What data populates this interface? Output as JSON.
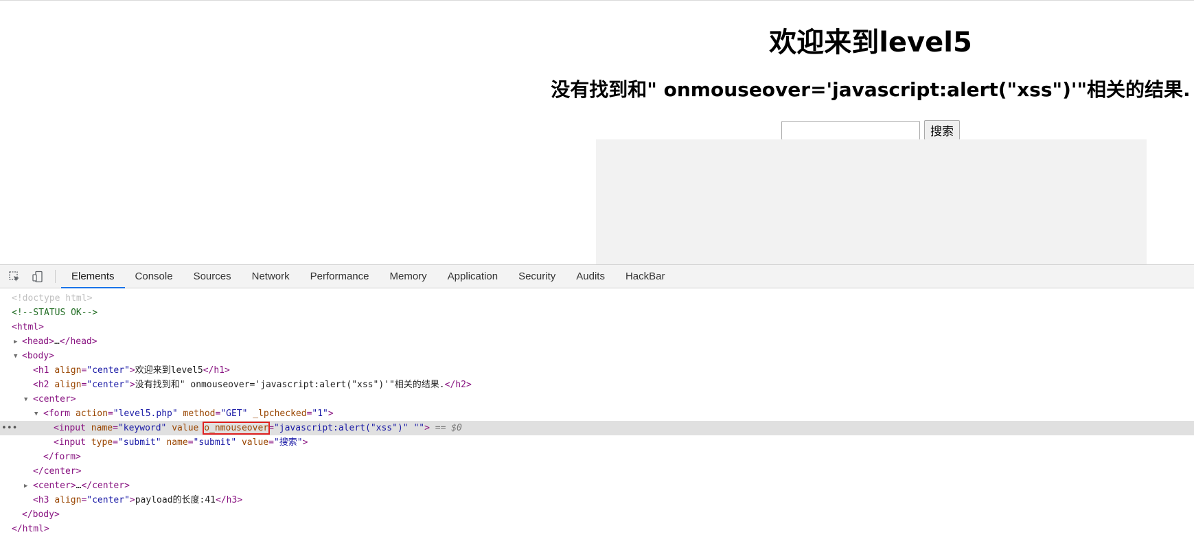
{
  "page": {
    "h1": "欢迎来到level5",
    "h2": "没有找到和\" onmouseover='javascript:alert(\"xss\")'\"相关的结果.",
    "input_value": "",
    "search_label": "搜索"
  },
  "devtools": {
    "tabs": [
      "Elements",
      "Console",
      "Sources",
      "Network",
      "Performance",
      "Memory",
      "Application",
      "Security",
      "Audits",
      "HackBar"
    ],
    "active_tab": "Elements",
    "icons": [
      "inspect-element-icon",
      "device-toolbar-icon"
    ],
    "dom": {
      "doctype": "<!doctype html>",
      "comment": "<!--STATUS OK-->",
      "html_open": "<html>",
      "head": "<head>",
      "head_ellipsis": "…",
      "head_close": "</head>",
      "body_open": "<body>",
      "h1_open": "<h1",
      "h1_attr": "align",
      "h1_val": "\"center\"",
      "h1_text": "欢迎来到level5",
      "h1_close": "</h1>",
      "h2_open": "<h2",
      "h2_attr": "align",
      "h2_val": "\"center\"",
      "h2_text": "没有找到和\" onmouseover='javascript:alert(\"xss\")'\"相关的结果.",
      "h2_close": "</h2>",
      "center_open": "<center>",
      "form_open": "<form",
      "form_action_attr": "action",
      "form_action_val": "\"level5.php\"",
      "form_method_attr": "method",
      "form_method_val": "\"GET\"",
      "form_lp_attr": "_lpchecked",
      "form_lp_val": "\"1\"",
      "input1_open": "<input",
      "input1_name_attr": "name",
      "input1_name_val": "\"keyword\"",
      "input1_value_attr": "value",
      "input1_injected_attr": "o_nmouseover",
      "input1_injected_val": "\"javascript:alert(\"xss\")\"",
      "input1_empty_attr": "\"\"",
      "input1_suffix": "== $0",
      "input2_open": "<input",
      "input2_type_attr": "type",
      "input2_type_val": "\"submit\"",
      "input2_name_attr": "name",
      "input2_name_val": "\"submit\"",
      "input2_value_attr": "value",
      "input2_value_val": "\"搜索\"",
      "form_close": "</form>",
      "center_close": "</center>",
      "center2_open": "<center>",
      "center2_ellipsis": "…",
      "center2_close": "</center>",
      "h3_open": "<h3",
      "h3_attr": "align",
      "h3_val": "\"center\"",
      "h3_text": "payload的长度:41",
      "h3_close": "</h3>",
      "body_close": "</body>",
      "html_close": "</html>"
    }
  }
}
